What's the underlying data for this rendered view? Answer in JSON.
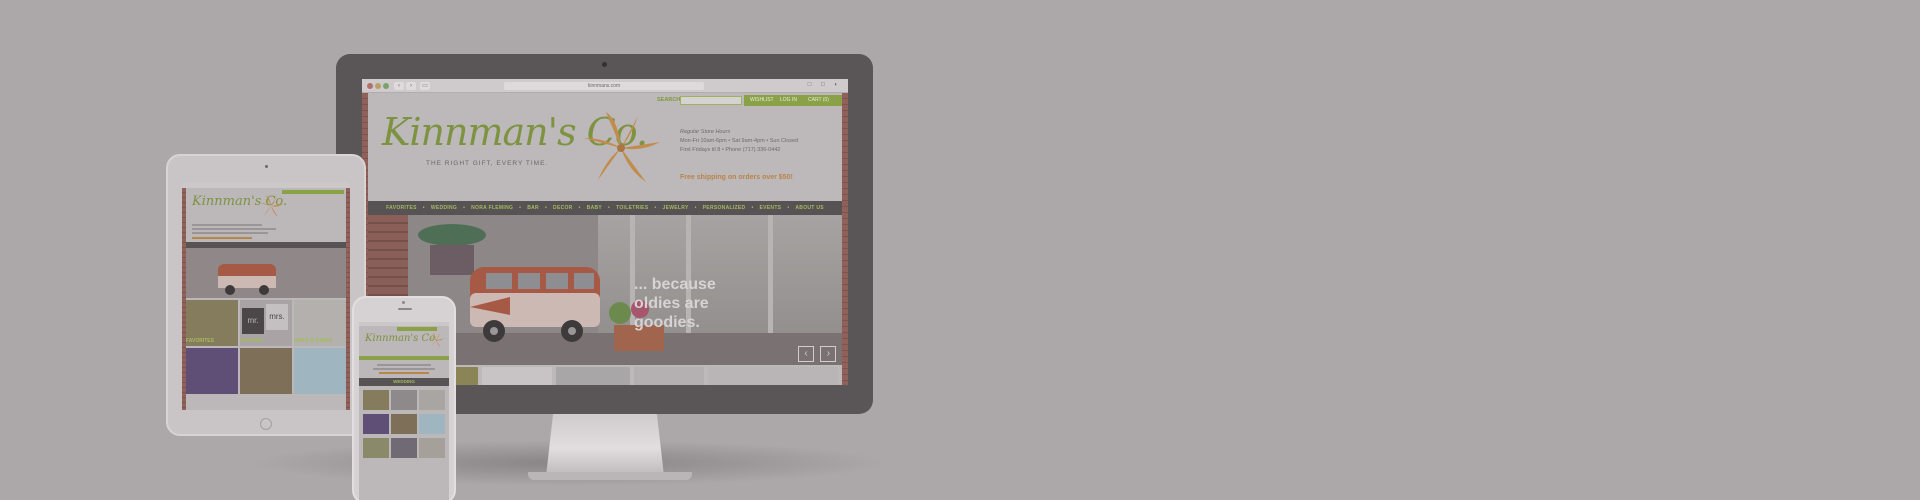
{
  "colors": {
    "page_background": "#aca7a9",
    "brand_green": "#8aa147",
    "brand_orange": "#b8854a",
    "nav_dark": "#575254"
  },
  "desktop": {
    "browser": {
      "url": "kinnmans.com",
      "back_icon": "chevron-left-icon",
      "forward_icon": "chevron-right-icon",
      "sidebar_icon": "sidebar-icon"
    },
    "utility_bar": {
      "search_label": "SEARCH",
      "wishlist": "WISHLIST",
      "login": "LOG IN",
      "cart": "CART (0)"
    },
    "header": {
      "logo_text": "Kinnman's Co.",
      "tagline": "THE RIGHT GIFT, EVERY TIME.",
      "hours_title": "Regular Store Hours",
      "hours_line1": "Mon-Fri 10am-6pm • Sat 9am-4pm • Sun Closed",
      "hours_line2": "First Fridays til 8 • Phone (717) 336-0442",
      "shipping": "Free shipping on orders over $50!"
    },
    "nav": [
      "FAVORITES",
      "WEDDING",
      "NORA FLEMING",
      "BAR",
      "DECOR",
      "BABY",
      "TOILETRIES",
      "JEWELRY",
      "PERSONALIZED",
      "EVENTS",
      "ABOUT US"
    ],
    "nav_separator": "•",
    "hero": {
      "line1": "... because",
      "line2": "oldies are",
      "line3": "goodies.",
      "prev_icon": "‹",
      "next_icon": "›"
    }
  },
  "tablet": {
    "logo_text": "Kinnman's Co.",
    "categories": [
      "FAVORITES",
      "WEDDING",
      "NORA FLEMING"
    ],
    "tile_text_mr": "mr.",
    "tile_text_mrs": "mrs."
  },
  "phone": {
    "logo_text": "Kinnman's Co.",
    "section_label": "WEDDING"
  }
}
